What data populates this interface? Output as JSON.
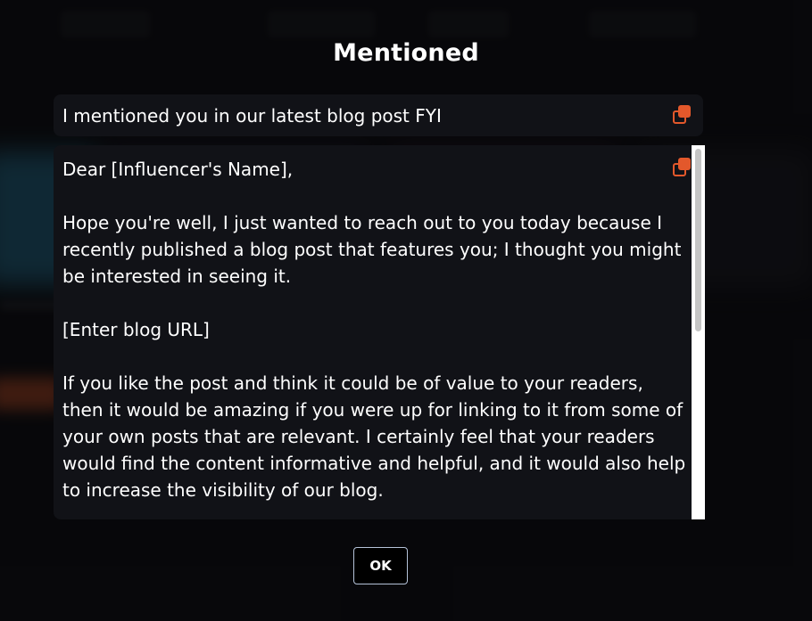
{
  "modal": {
    "title": "Mentioned",
    "subject": "I mentioned you in our latest blog post FYI",
    "body": {
      "greeting": "Dear [Influencer's Name],",
      "paragraph1": "Hope you're well, I just wanted to reach out to you today because I recently published a blog post that features you; I thought you might be interested in seeing it.",
      "url_placeholder": "[Enter blog URL]",
      "paragraph2": "If you like the post and think it could be of value to your readers, then it would be amazing if you were up for linking to it from some of your own posts that are relevant. I certainly feel that your readers would find the content informative and helpful, and it would also help to increase the visibility of our blog."
    },
    "ok_label": "OK"
  },
  "icons": {
    "subject_copy": "copy-icon",
    "body_copy": "copy-icon"
  },
  "colors": {
    "accent": "#e3582b",
    "surface": "#111217",
    "background": "#0b0b0e",
    "button_border": "#b5c3d9"
  }
}
